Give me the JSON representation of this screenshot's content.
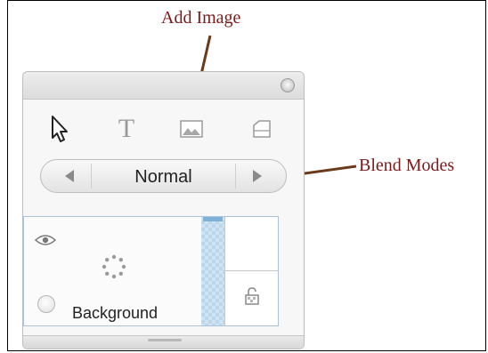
{
  "annotations": {
    "add_image": "Add Image",
    "blend_modes": "Blend Modes"
  },
  "toolbar": {
    "tools": [
      {
        "name": "select",
        "icon": "arrow-cursor-icon"
      },
      {
        "name": "text",
        "icon": "text-t-icon",
        "glyph": "T"
      },
      {
        "name": "add-image",
        "icon": "image-icon"
      },
      {
        "name": "shape",
        "icon": "shape-icon"
      }
    ]
  },
  "blend": {
    "mode": "Normal",
    "prev_icon": "triangle-left-icon",
    "next_icon": "triangle-right-icon"
  },
  "layers": [
    {
      "name": "Background",
      "visible": true,
      "locked": false
    }
  ],
  "colors": {
    "annotation": "#7a1a1a",
    "pointer_line": "#6a3a1a",
    "layer_selection": "#aac3d8",
    "scrollbar": "#cfe4f3"
  }
}
